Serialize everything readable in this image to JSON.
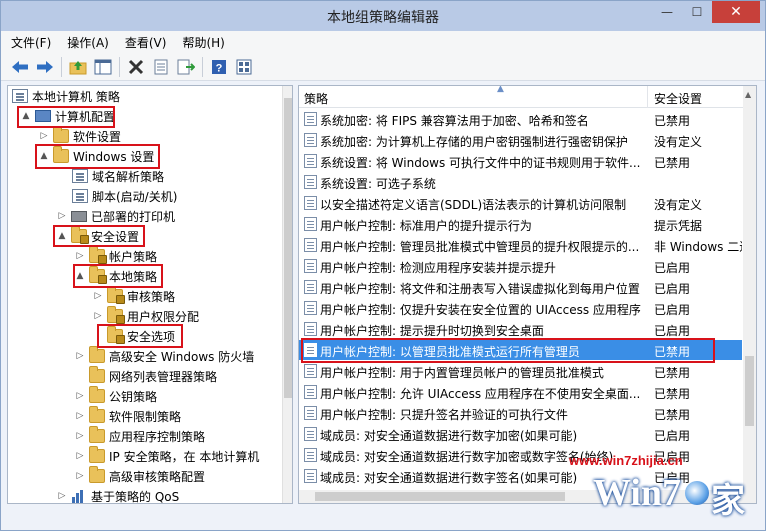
{
  "window": {
    "title": "本地组策略编辑器",
    "minimize": "—",
    "maximize": "☐",
    "close": "✕"
  },
  "menubar": [
    "文件(F)",
    "操作(A)",
    "查看(V)",
    "帮助(H)"
  ],
  "toolbar": [
    "back-arrow-icon",
    "forward-arrow-icon",
    "up-folder-icon",
    "show-tree-icon",
    "delete-icon",
    "properties-icon",
    "export-list-icon",
    "help-icon",
    "view-icon"
  ],
  "tree": [
    {
      "label": "本地计算机 策略",
      "icon": "policy-doc",
      "expander": ""
    },
    {
      "label": "计算机配置",
      "icon": "computer",
      "expander": "▲"
    },
    {
      "label": "软件设置",
      "icon": "folder",
      "expander": "▷"
    },
    {
      "label": "Windows 设置",
      "icon": "folder",
      "expander": "▲"
    },
    {
      "label": "域名解析策略",
      "icon": "policy-doc",
      "expander": ""
    },
    {
      "label": "脚本(启动/关机)",
      "icon": "policy-doc",
      "expander": ""
    },
    {
      "label": "已部署的打印机",
      "icon": "printer",
      "expander": "▷"
    },
    {
      "label": "安全设置",
      "icon": "folder-lock",
      "expander": "▲"
    },
    {
      "label": "帐户策略",
      "icon": "folder-lock",
      "expander": "▷"
    },
    {
      "label": "本地策略",
      "icon": "folder-lock",
      "expander": "▲"
    },
    {
      "label": "审核策略",
      "icon": "folder-lock",
      "expander": "▷"
    },
    {
      "label": "用户权限分配",
      "icon": "folder-lock",
      "expander": "▷"
    },
    {
      "label": "安全选项",
      "icon": "folder-lock",
      "expander": ""
    },
    {
      "label": "高级安全 Windows 防火墙",
      "icon": "folder",
      "expander": "▷"
    },
    {
      "label": "网络列表管理器策略",
      "icon": "folder",
      "expander": ""
    },
    {
      "label": "公钥策略",
      "icon": "folder",
      "expander": "▷"
    },
    {
      "label": "软件限制策略",
      "icon": "folder",
      "expander": "▷"
    },
    {
      "label": "应用程序控制策略",
      "icon": "folder",
      "expander": "▷"
    },
    {
      "label": "IP 安全策略，在 本地计算机",
      "icon": "folder",
      "expander": "▷"
    },
    {
      "label": "高级审核策略配置",
      "icon": "folder",
      "expander": "▷"
    },
    {
      "label": "基于策略的 QoS",
      "icon": "chart",
      "expander": "▷"
    }
  ],
  "list": {
    "headers": {
      "policy": "策略",
      "setting": "安全设置",
      "sort_arrow": "▲"
    },
    "rows": [
      {
        "policy": "系统加密: 将 FIPS 兼容算法用于加密、哈希和签名",
        "setting": "已禁用"
      },
      {
        "policy": "系统加密: 为计算机上存储的用户密钥强制进行强密钥保护",
        "setting": "没有定义"
      },
      {
        "policy": "系统设置: 将 Windows 可执行文件中的证书规则用于软件...",
        "setting": "已禁用"
      },
      {
        "policy": "系统设置: 可选子系统",
        "setting": ""
      },
      {
        "policy": "以安全描述符定义语言(SDDL)语法表示的计算机访问限制",
        "setting": "没有定义"
      },
      {
        "policy": "用户帐户控制: 标准用户的提升提示行为",
        "setting": "提示凭据"
      },
      {
        "policy": "用户帐户控制: 管理员批准模式中管理员的提升权限提示的...",
        "setting": "非 Windows 二进"
      },
      {
        "policy": "用户帐户控制: 检测应用程序安装并提示提升",
        "setting": "已启用"
      },
      {
        "policy": "用户帐户控制: 将文件和注册表写入错误虚拟化到每用户位置",
        "setting": "已启用"
      },
      {
        "policy": "用户帐户控制: 仅提升安装在安全位置的 UIAccess 应用程序",
        "setting": "已启用"
      },
      {
        "policy": "用户帐户控制: 提示提升时切换到安全桌面",
        "setting": "已启用"
      },
      {
        "policy": "用户帐户控制: 以管理员批准模式运行所有管理员",
        "setting": "已禁用"
      },
      {
        "policy": "用户帐户控制: 用于内置管理员帐户的管理员批准模式",
        "setting": "已禁用"
      },
      {
        "policy": "用户帐户控制: 允许 UIAccess 应用程序在不使用安全桌面...",
        "setting": "已禁用"
      },
      {
        "policy": "用户帐户控制: 只提升签名并验证的可执行文件",
        "setting": "已禁用"
      },
      {
        "policy": "域成员: 对安全通道数据进行数字加密(如果可能)",
        "setting": "已启用"
      },
      {
        "policy": "域成员: 对安全通道数据进行数字加密或数字签名(始终)",
        "setting": "已启用"
      },
      {
        "policy": "域成员: 对安全通道数据进行数字签名(如果可能)",
        "setting": "已启用"
      }
    ]
  },
  "watermark": {
    "url": "www.win7zhijia.cn",
    "logo_w": "Win7",
    "logo_jia": "家"
  },
  "colors": {
    "highlight_box": "#d8121a",
    "selected_row": "#3a8ee6",
    "close_button": "#c7403a"
  }
}
